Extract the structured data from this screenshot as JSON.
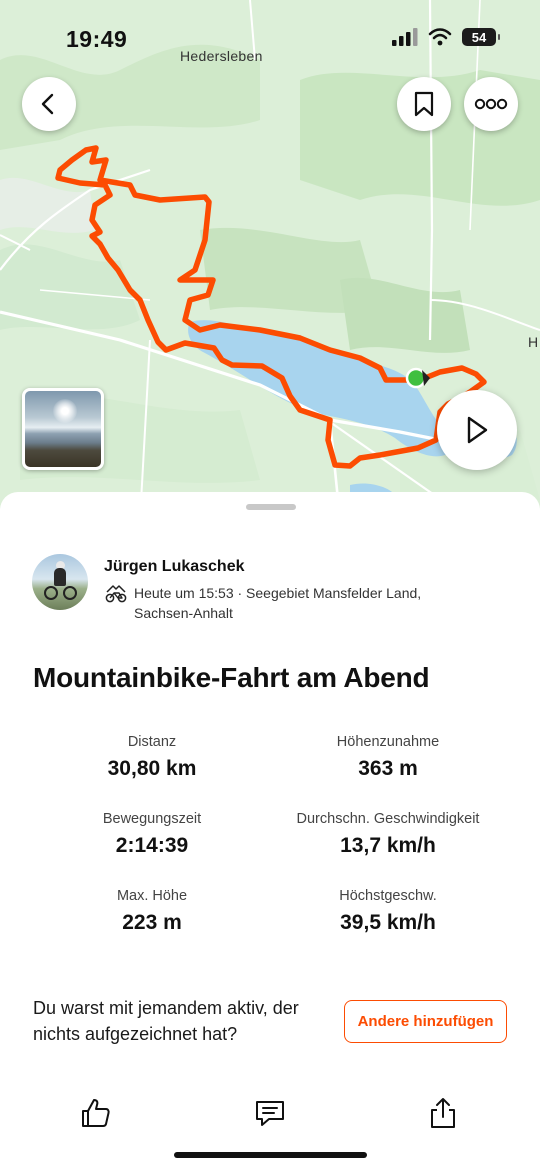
{
  "status_bar": {
    "time": "19:49",
    "battery": "54"
  },
  "map": {
    "place_labels": [
      "Hedersleben",
      "H"
    ],
    "colors": {
      "route": "#fc4c02",
      "lake": "#a8d4ee",
      "land": "#dcefd8",
      "start_marker": "#3fbf3f"
    }
  },
  "controls": {
    "back_icon": "chevron-left-icon",
    "bookmark_icon": "bookmark-icon",
    "more_icon": "more-icon",
    "play_icon": "play-icon"
  },
  "athlete": {
    "name": "Jürgen Lukaschek",
    "timestamp_line1": "Heute um 15:53 · Seegebiet Mansfelder Land,",
    "timestamp_line2": "Sachsen-Anhalt"
  },
  "activity": {
    "title": "Mountainbike-Fahrt am Abend",
    "stats": [
      {
        "label": "Distanz",
        "value": "30,80 km"
      },
      {
        "label": "Höhenzunahme",
        "value": "363 m"
      },
      {
        "label": "Bewegungszeit",
        "value": "2:14:39"
      },
      {
        "label": "Durchschn. Geschwindigkeit",
        "value": "13,7 km/h"
      },
      {
        "label": "Max. Höhe",
        "value": "223 m"
      },
      {
        "label": "Höchstgeschw.",
        "value": "39,5 km/h"
      }
    ]
  },
  "prompt": {
    "text_line1": "Du warst mit jemandem aktiv, der",
    "text_line2": "nichts aufgezeichnet hat?",
    "button_label": "Andere hinzufügen"
  },
  "actions": {
    "kudos_icon": "thumbs-up-icon",
    "comment_icon": "comment-icon",
    "share_icon": "share-icon"
  },
  "accent_color": "#fc4c02"
}
